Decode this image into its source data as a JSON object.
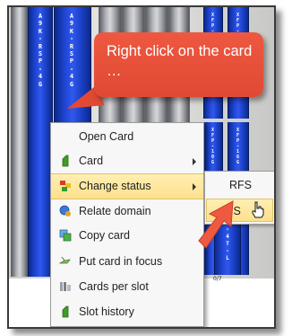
{
  "callout": {
    "text": "Right click on the card …"
  },
  "rack": {
    "cards_left": [
      "A9K-RSP-4G",
      "A9K-RSP-4G"
    ],
    "cards_right_top": [
      "XFP-10G",
      "XFP-10G"
    ],
    "cards_right_mid": [
      "XFP-10G",
      "XFP-16G"
    ],
    "card_mid_lower": "-4T-L",
    "slot_label": "0/7"
  },
  "context_menu": {
    "items": [
      {
        "label": "Open Card",
        "icon": "none",
        "submenu": false
      },
      {
        "label": "Card",
        "icon": "green-card-icon",
        "submenu": true
      },
      {
        "label": "Change status",
        "icon": "status-blocks-icon",
        "submenu": true,
        "highlighted": true
      },
      {
        "label": "Relate domain",
        "icon": "domain-globe-icon",
        "submenu": false
      },
      {
        "label": "Copy card",
        "icon": "copy-card-icon",
        "submenu": false
      },
      {
        "label": "Put card in focus",
        "icon": "focus-pin-icon",
        "submenu": false
      },
      {
        "label": "Cards per slot",
        "icon": "cards-per-slot-icon",
        "submenu": false
      },
      {
        "label": "Slot history",
        "icon": "history-card-icon",
        "submenu": false
      }
    ]
  },
  "status_submenu": {
    "items": [
      {
        "label": "RFS",
        "highlighted": false
      },
      {
        "label": "IS",
        "highlighted": true
      }
    ]
  },
  "colors": {
    "callout": "#e04a34",
    "highlight": "#fde08c",
    "card_blue": "#2146d6"
  }
}
